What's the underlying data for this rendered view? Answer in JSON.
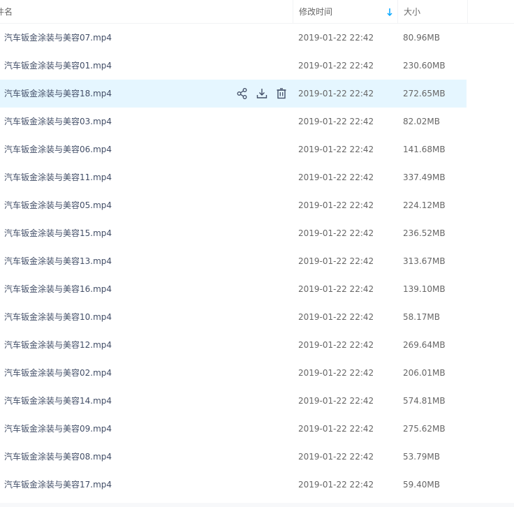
{
  "header": {
    "name": "件名",
    "time": "修改时间",
    "size": "大小"
  },
  "rows": [
    {
      "name": "汽车钣金涂装与美容07.mp4",
      "time": "2019-01-22 22:42",
      "size": "80.96MB"
    },
    {
      "name": "汽车钣金涂装与美容01.mp4",
      "time": "2019-01-22 22:42",
      "size": "230.60MB"
    },
    {
      "name": "汽车钣金涂装与美容18.mp4",
      "time": "2019-01-22 22:42",
      "size": "272.65MB"
    },
    {
      "name": "汽车钣金涂装与美容03.mp4",
      "time": "2019-01-22 22:42",
      "size": "82.02MB"
    },
    {
      "name": "汽车钣金涂装与美容06.mp4",
      "time": "2019-01-22 22:42",
      "size": "141.68MB"
    },
    {
      "name": "汽车钣金涂装与美容11.mp4",
      "time": "2019-01-22 22:42",
      "size": "337.49MB"
    },
    {
      "name": "汽车钣金涂装与美容05.mp4",
      "time": "2019-01-22 22:42",
      "size": "224.12MB"
    },
    {
      "name": "汽车钣金涂装与美容15.mp4",
      "time": "2019-01-22 22:42",
      "size": "236.52MB"
    },
    {
      "name": "汽车钣金涂装与美容13.mp4",
      "time": "2019-01-22 22:42",
      "size": "313.67MB"
    },
    {
      "name": "汽车钣金涂装与美容16.mp4",
      "time": "2019-01-22 22:42",
      "size": "139.10MB"
    },
    {
      "name": "汽车钣金涂装与美容10.mp4",
      "time": "2019-01-22 22:42",
      "size": "58.17MB"
    },
    {
      "name": "汽车钣金涂装与美容12.mp4",
      "time": "2019-01-22 22:42",
      "size": "269.64MB"
    },
    {
      "name": "汽车钣金涂装与美容02.mp4",
      "time": "2019-01-22 22:42",
      "size": "206.01MB"
    },
    {
      "name": "汽车钣金涂装与美容14.mp4",
      "time": "2019-01-22 22:42",
      "size": "574.81MB"
    },
    {
      "name": "汽车钣金涂装与美容09.mp4",
      "time": "2019-01-22 22:42",
      "size": "275.62MB"
    },
    {
      "name": "汽车钣金涂装与美容08.mp4",
      "time": "2019-01-22 22:42",
      "size": "53.79MB"
    },
    {
      "name": "汽车钣金涂装与美容17.mp4",
      "time": "2019-01-22 22:42",
      "size": "59.40MB"
    }
  ],
  "hover_row_index": 2,
  "icons": {
    "share": "share-icon",
    "download": "download-icon",
    "delete": "trash-icon",
    "sort": "sort-down-arrow-icon"
  },
  "colors": {
    "hover_bg": "#e5f6ff",
    "accent": "#06a7ff",
    "text": "#424e67"
  }
}
